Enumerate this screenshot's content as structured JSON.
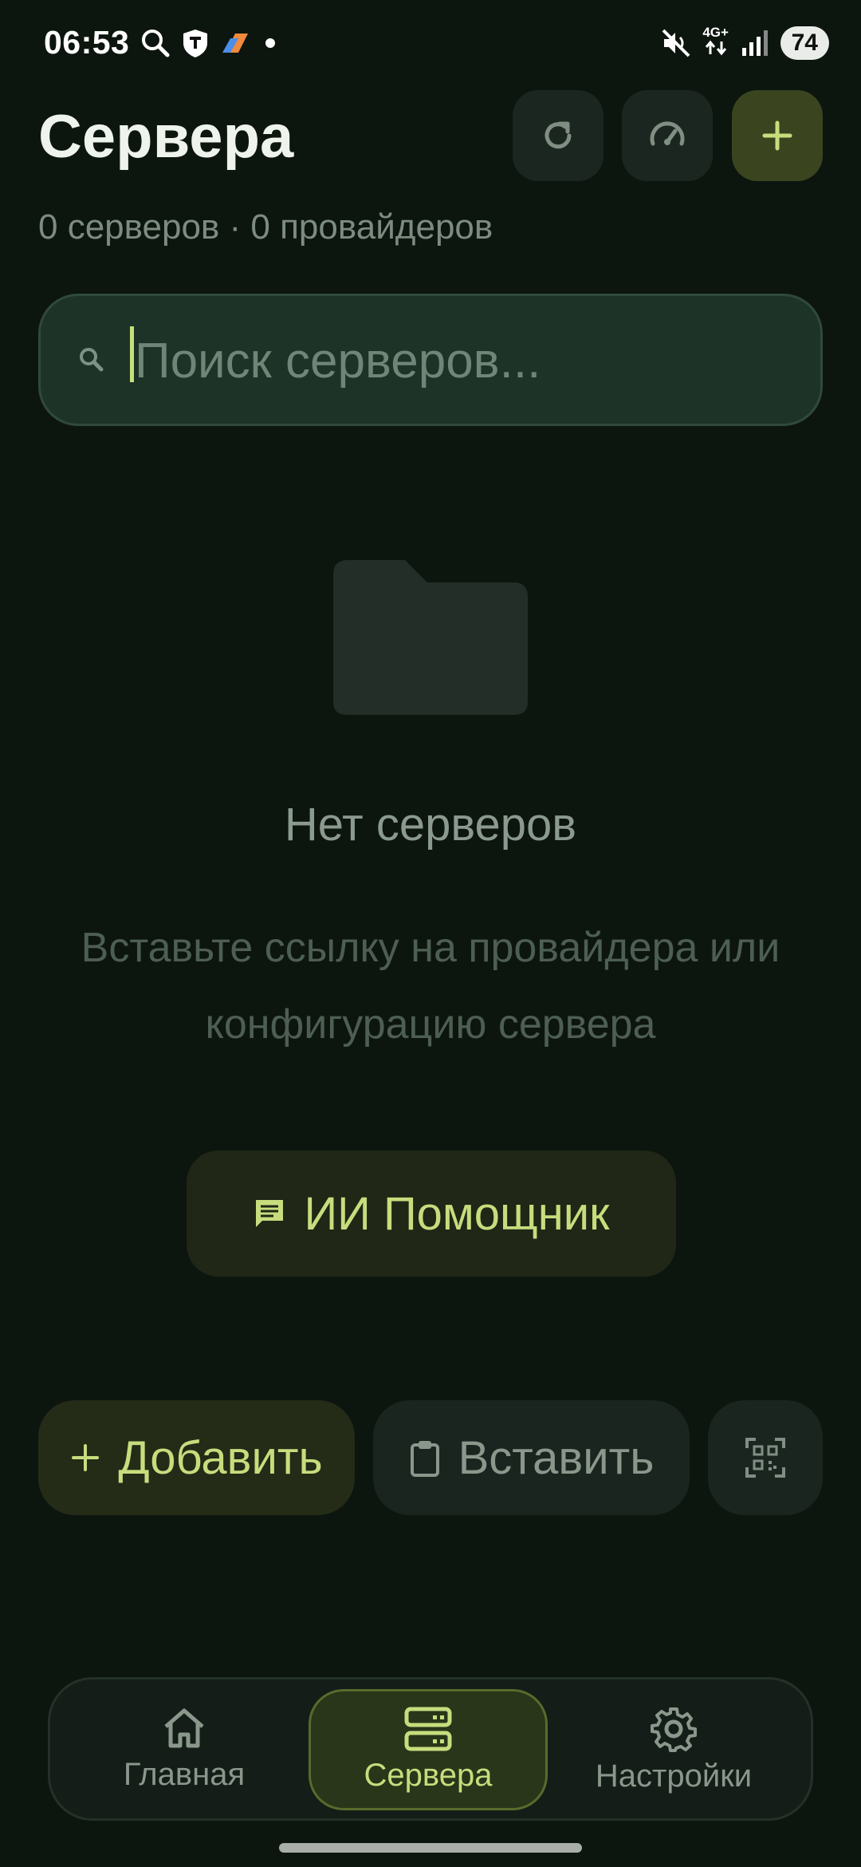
{
  "status_bar": {
    "time": "06:53",
    "network": "4G+",
    "battery": "74"
  },
  "header": {
    "title": "Сервера",
    "subtitle": "0 серверов · 0 провайдеров"
  },
  "search": {
    "placeholder": "Поиск серверов...",
    "value": ""
  },
  "empty_state": {
    "title": "Нет серверов",
    "description": "Вставьте ссылку на провайдера или конфигурацию сервера"
  },
  "ai_button": {
    "label": "ИИ Помощник"
  },
  "actions": {
    "add_label": "Добавить",
    "paste_label": "Вставить"
  },
  "bottom_nav": {
    "items": [
      {
        "label": "Главная",
        "icon": "home-icon"
      },
      {
        "label": "Сервера",
        "icon": "servers-icon",
        "active": true
      },
      {
        "label": "Настройки",
        "icon": "gear-icon"
      }
    ]
  },
  "colors": {
    "background": "#0d150f",
    "accent": "#c7dd7d",
    "surface": "#1c2620"
  }
}
